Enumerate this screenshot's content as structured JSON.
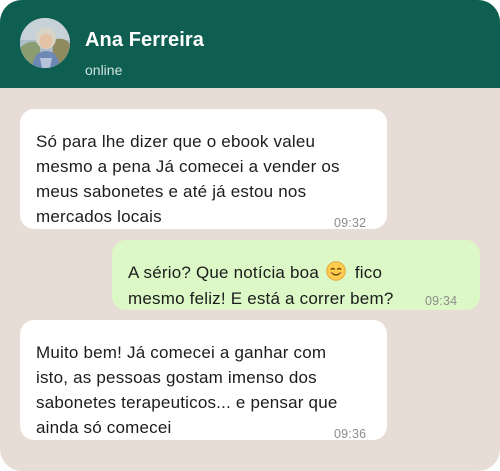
{
  "header": {
    "contact_name": "Ana Ferreira",
    "status": "online"
  },
  "messages": [
    {
      "direction": "incoming",
      "text": "Só para lhe dizer que o ebook valeu\nmesmo a pena Já comecei a vender os\nmeus sabonetes e até já estou nos\nmercados locais",
      "time": "09:32"
    },
    {
      "direction": "outgoing",
      "text_before_emoji": "A sério? Que notícia boa",
      "emoji": "smiling-face-icon",
      "text_after_emoji": "fico",
      "text_line2": "mesmo feliz! E está a correr bem?",
      "time": "09:34"
    },
    {
      "direction": "incoming",
      "text": "Muito bem! Já comecei a ganhar com\nisto, as pessoas gostam imenso dos\nsabonetes terapeuticos... e pensar que\nainda só comecei",
      "time": "09:36"
    }
  ],
  "colors": {
    "header_bg": "#0e5e52",
    "chat_bg": "#e8ddd6",
    "incoming_bubble": "#ffffff",
    "outgoing_bubble": "#dcf8c6",
    "timestamp": "#8c8c8c"
  }
}
